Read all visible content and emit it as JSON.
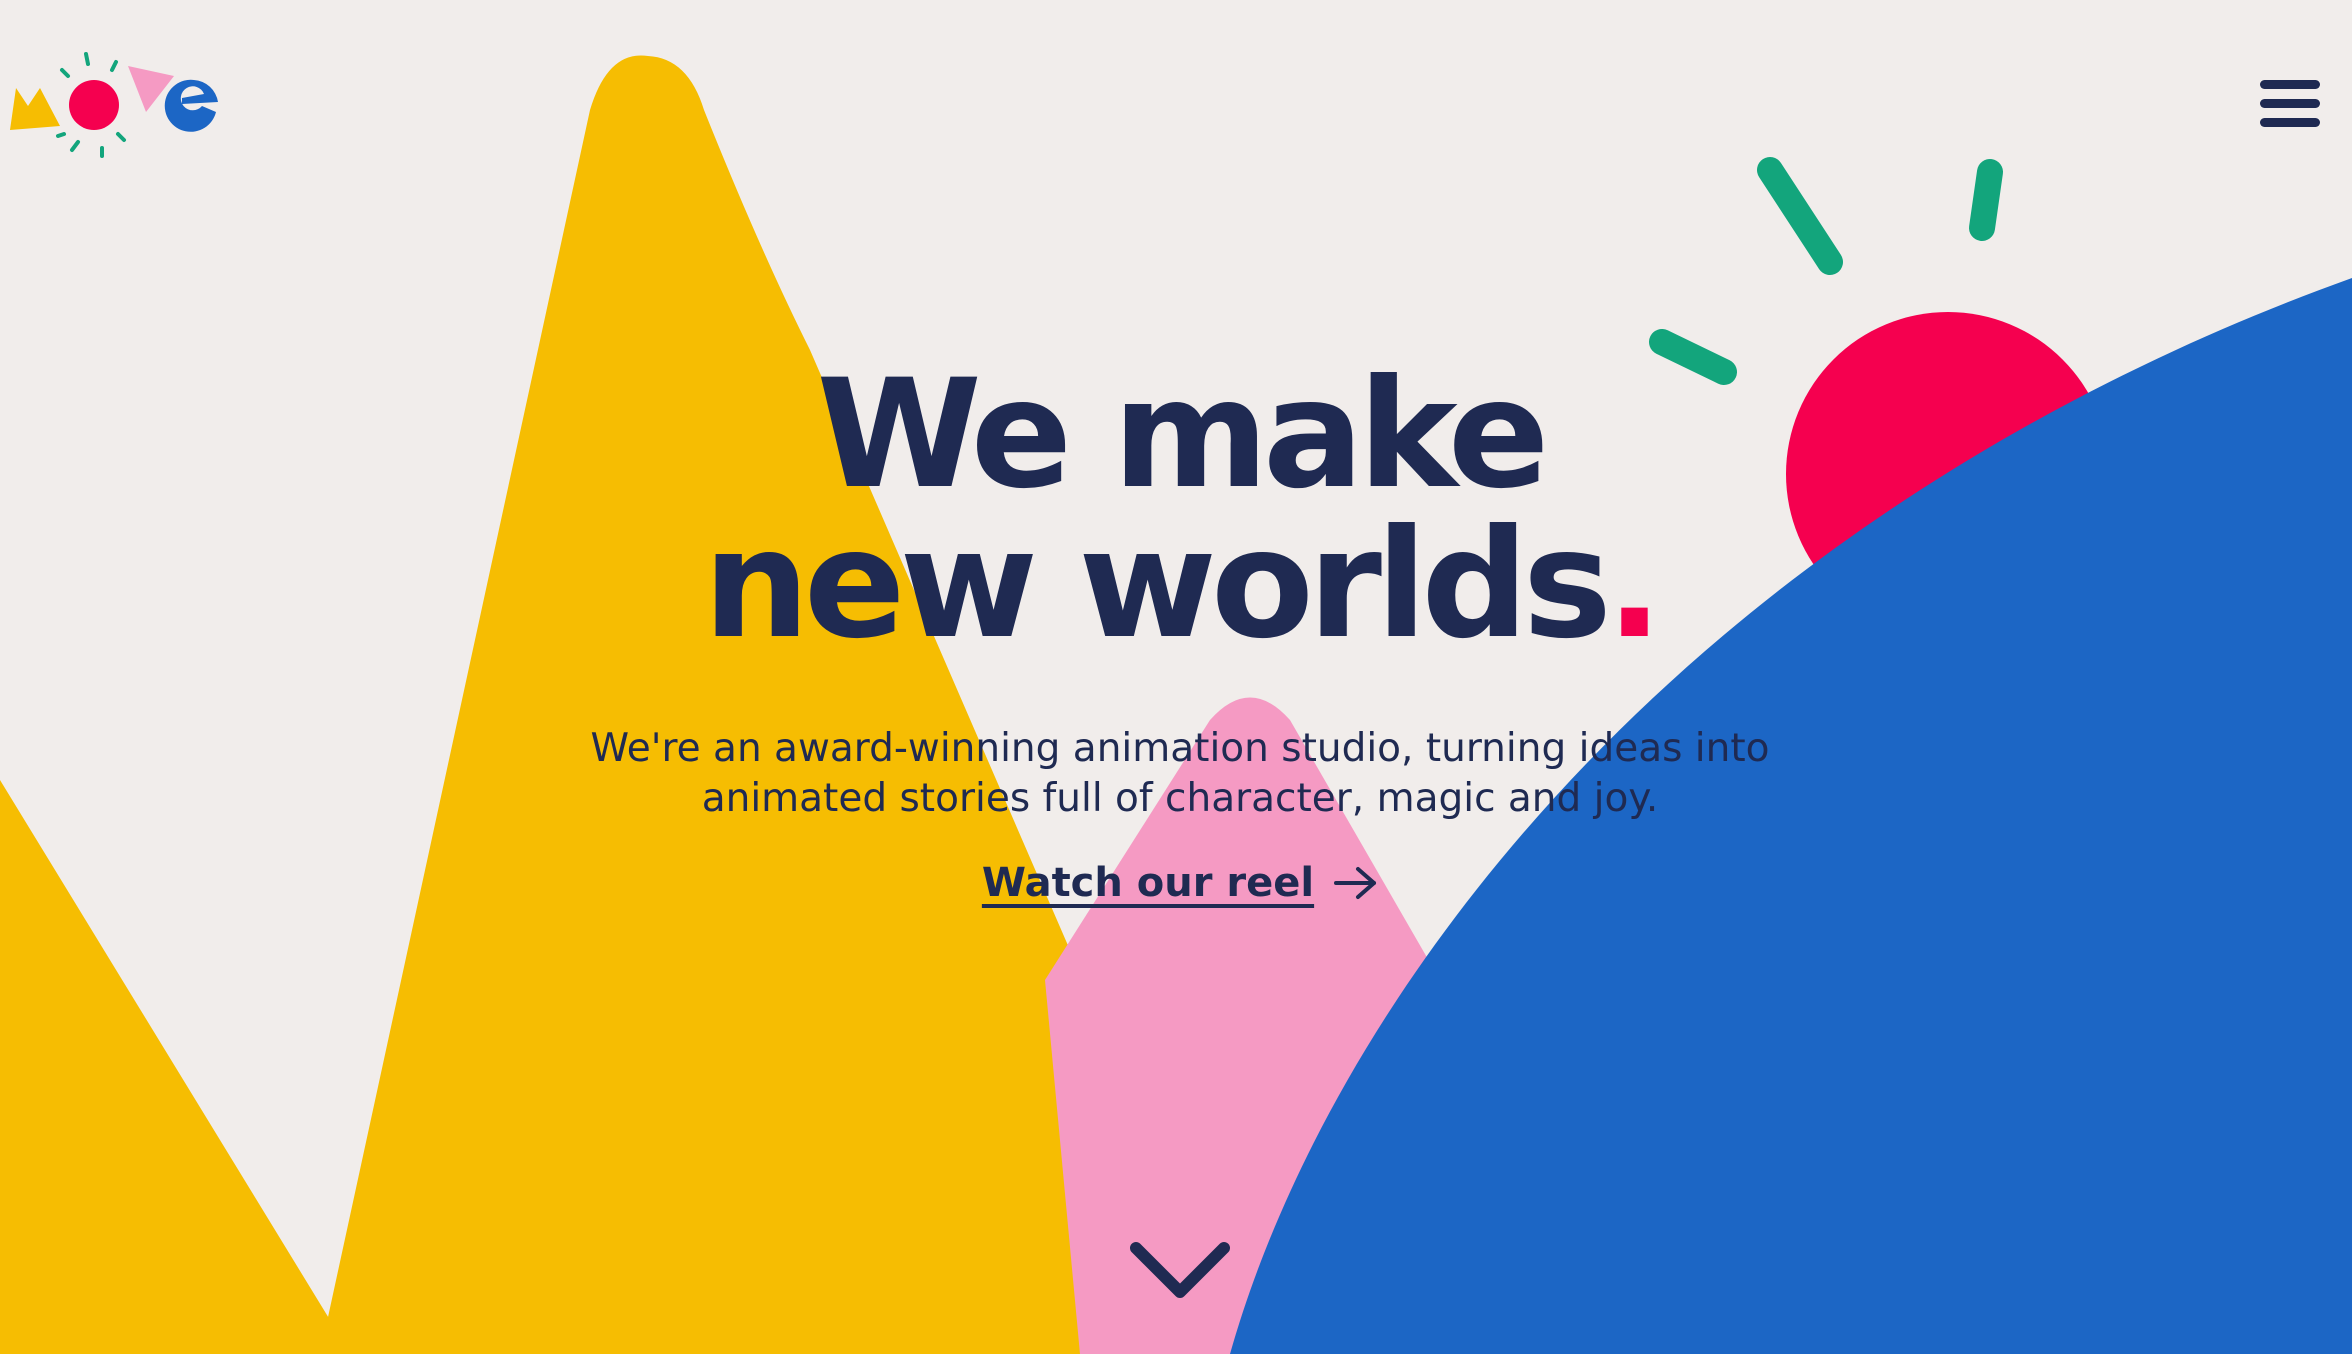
{
  "brand": {
    "logo_letters": "move",
    "icon": "move-logo"
  },
  "nav": {
    "menu_icon": "hamburger-menu-icon"
  },
  "hero": {
    "headline_line1": "We make",
    "headline_line2": "new worlds",
    "headline_dot": ".",
    "subtitle_line1": "We're an award-winning animation studio, turning ideas into",
    "subtitle_line2": "animated stories full of character, magic and joy.",
    "cta_label": "Watch our reel",
    "cta_icon": "arrow-right-icon",
    "scroll_icon": "chevron-down-icon"
  },
  "colors": {
    "background": "#f1edeb",
    "navy": "#1f2a52",
    "yellow": "#f6bd02",
    "pink": "#f59ac3",
    "blue": "#1c66c5",
    "red": "#f5004f",
    "green": "#13a57c"
  }
}
